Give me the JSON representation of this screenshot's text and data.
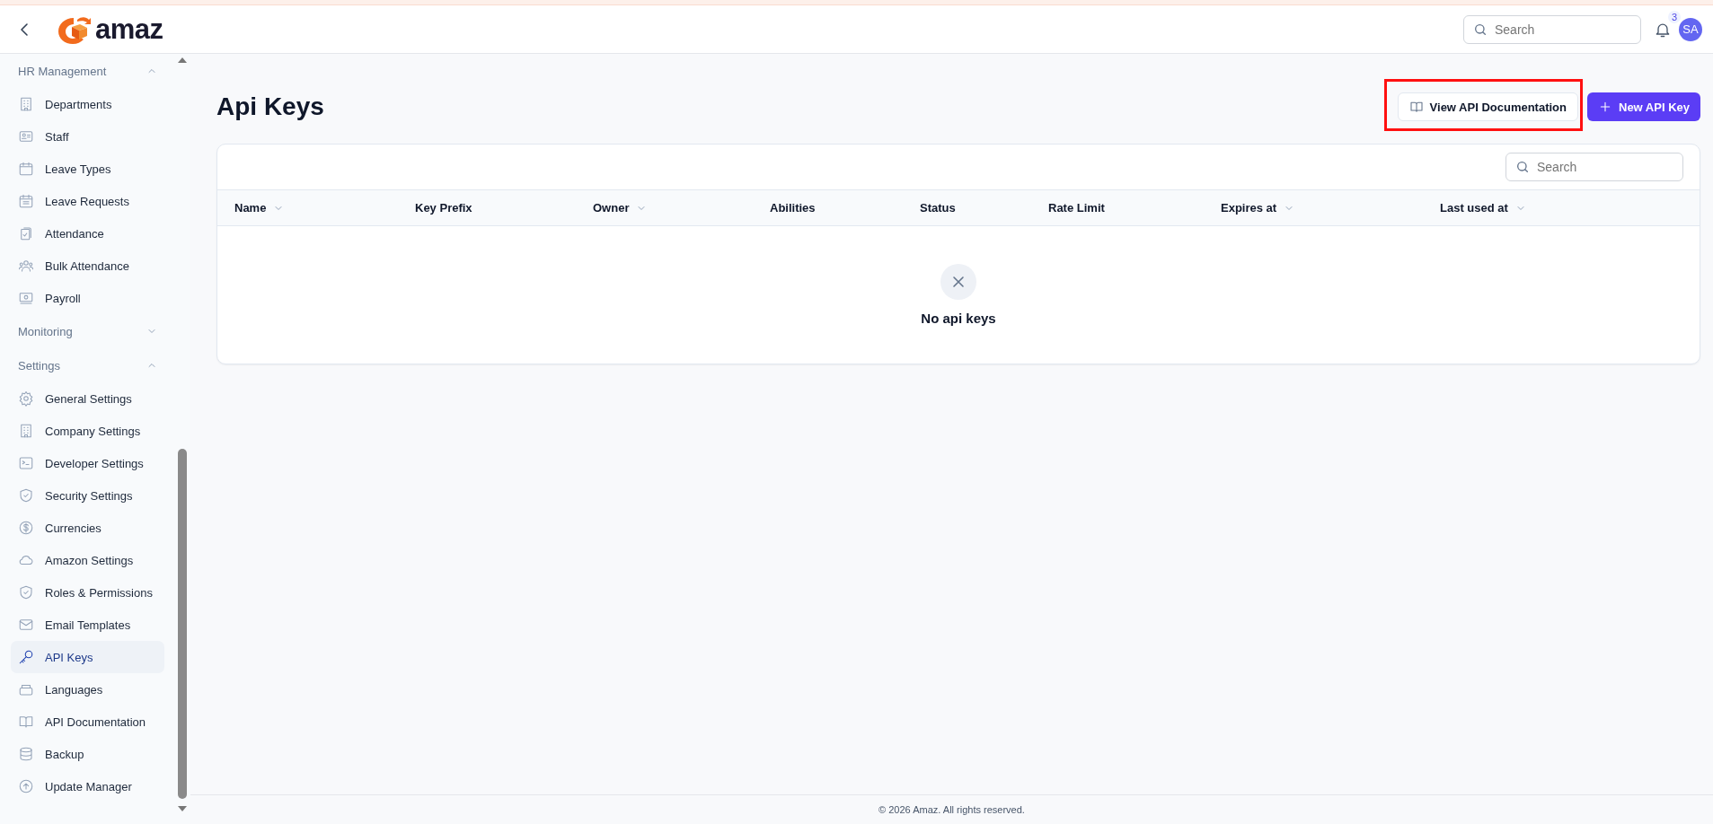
{
  "header": {
    "brand": "amaz",
    "search": {
      "placeholder": "Search"
    },
    "notifications": {
      "count": "3"
    },
    "avatar": {
      "initials": "SA"
    }
  },
  "sidebar": {
    "sections": [
      {
        "title": "HR Management",
        "expanded": true,
        "items": [
          {
            "label": "Departments",
            "selected": false
          },
          {
            "label": "Staff",
            "selected": false
          },
          {
            "label": "Leave Types",
            "selected": false
          },
          {
            "label": "Leave Requests",
            "selected": false
          },
          {
            "label": "Attendance",
            "selected": false
          },
          {
            "label": "Bulk Attendance",
            "selected": false
          },
          {
            "label": "Payroll",
            "selected": false
          }
        ]
      },
      {
        "title": "Monitoring",
        "expanded": false
      },
      {
        "title": "Settings",
        "expanded": true,
        "items": [
          {
            "label": "General Settings",
            "selected": false
          },
          {
            "label": "Company Settings",
            "selected": false
          },
          {
            "label": "Developer Settings",
            "selected": false
          },
          {
            "label": "Security Settings",
            "selected": false
          },
          {
            "label": "Currencies",
            "selected": false
          },
          {
            "label": "Amazon Settings",
            "selected": false
          },
          {
            "label": "Roles & Permissions",
            "selected": false
          },
          {
            "label": "Email Templates",
            "selected": false
          },
          {
            "label": "API Keys",
            "selected": true
          },
          {
            "label": "Languages",
            "selected": false
          },
          {
            "label": "API Documentation",
            "selected": false
          },
          {
            "label": "Backup",
            "selected": false
          },
          {
            "label": "Update Manager",
            "selected": false
          }
        ]
      }
    ]
  },
  "page": {
    "title": "Api Keys",
    "actions": [
      {
        "kind": "secondary",
        "label": "View API Documentation",
        "highlighted": true
      },
      {
        "kind": "primary",
        "label": "New API Key",
        "highlighted": false
      }
    ]
  },
  "table": {
    "search": {
      "placeholder": "Search"
    },
    "columns": [
      {
        "label": "Name",
        "sortable": true
      },
      {
        "label": "Key Prefix",
        "sortable": false
      },
      {
        "label": "Owner",
        "sortable": true
      },
      {
        "label": "Abilities",
        "sortable": false
      },
      {
        "label": "Status",
        "sortable": false
      },
      {
        "label": "Rate Limit",
        "sortable": false
      },
      {
        "label": "Expires at",
        "sortable": true
      },
      {
        "label": "Last used at",
        "sortable": true
      }
    ],
    "empty_message": "No api keys"
  },
  "footer": {
    "text": "© 2026 Amaz. All rights reserved."
  }
}
